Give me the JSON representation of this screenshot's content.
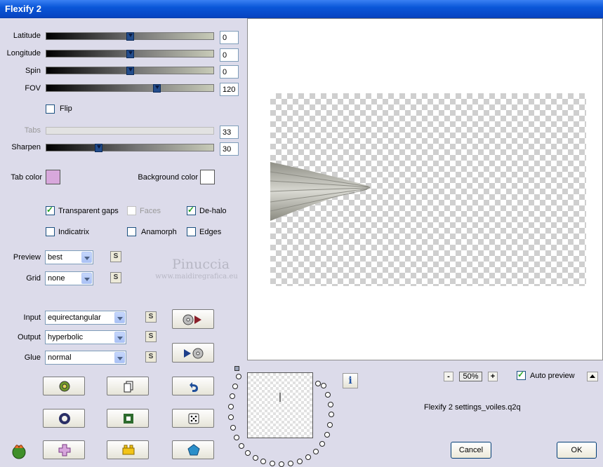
{
  "window": {
    "title": "Flexify 2"
  },
  "sliders": [
    {
      "label": "Latitude",
      "value": "0",
      "level": 0.5,
      "enabled": true
    },
    {
      "label": "Longitude",
      "value": "0",
      "level": 0.5,
      "enabled": true
    },
    {
      "label": "Spin",
      "value": "0",
      "level": 0.5,
      "enabled": true
    },
    {
      "label": "FOV",
      "value": "120",
      "level": 0.66,
      "enabled": true
    },
    {
      "label": "Tabs",
      "value": "33",
      "level": 0.33,
      "enabled": false
    },
    {
      "label": "Sharpen",
      "value": "30",
      "level": 0.3,
      "enabled": true
    }
  ],
  "flip": {
    "label": "Flip",
    "checked": false
  },
  "colors": {
    "tab_color_label": "Tab color",
    "tab_color": "#d8a8dc",
    "background_color_label": "Background color",
    "background_color": "#ffffff"
  },
  "options": {
    "transparent_gaps": {
      "label": "Transparent gaps",
      "checked": true
    },
    "faces": {
      "label": "Faces",
      "checked": false,
      "enabled": false
    },
    "de_halo": {
      "label": "De-halo",
      "checked": true
    },
    "indicatrix": {
      "label": "Indicatrix",
      "checked": false
    },
    "anamorph": {
      "label": "Anamorph",
      "checked": false
    },
    "edges": {
      "label": "Edges",
      "checked": false
    }
  },
  "preview_select": {
    "label": "Preview",
    "value": "best"
  },
  "grid_select": {
    "label": "Grid",
    "value": "none"
  },
  "input_select": {
    "label": "Input",
    "value": "equirectangular"
  },
  "output_select": {
    "label": "Output",
    "value": "hyperbolic"
  },
  "glue_select": {
    "label": "Glue",
    "value": "normal"
  },
  "s_button_label": "S",
  "watermark": {
    "name": "Pinuccia",
    "site": "www.maidiregrafica.eu"
  },
  "zoom": {
    "value": "50%",
    "minus": "-",
    "plus": "+"
  },
  "auto_preview": {
    "label": "Auto preview",
    "checked": true
  },
  "settings_file": "Flexify 2 settings_voiles.q2q",
  "buttons": {
    "cancel": "Cancel",
    "ok": "OK",
    "info": "i"
  },
  "colors_theme": {
    "titlebar": "#0a56d8",
    "panel": "#dcdbea",
    "thumb": "#234c8c",
    "check": "#21a121"
  }
}
